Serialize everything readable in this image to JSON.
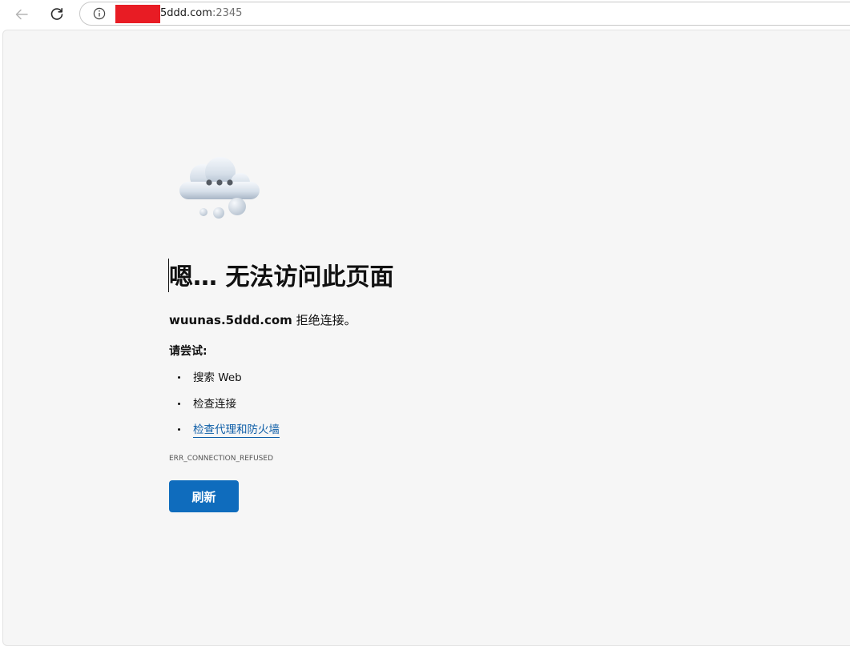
{
  "browser": {
    "url_visible": "5ddd.com",
    "url_port": ":2345",
    "icons": {
      "back": "arrow-left-icon",
      "refresh": "refresh-icon",
      "site_info": "info-circle-icon"
    }
  },
  "error_page": {
    "illustration": "cloud-icon",
    "title": "嗯… 无法访问此页面",
    "refused_host": "wuunas.5ddd.com",
    "refused_suffix": " 拒绝连接。",
    "try_heading": "请尝试:",
    "suggestions": [
      {
        "label": "搜索 Web",
        "link": false
      },
      {
        "label": "检查连接",
        "link": false
      },
      {
        "label": "检查代理和防火墙",
        "link": true
      }
    ],
    "error_code": "ERR_CONNECTION_REFUSED",
    "reload_label": "刷新",
    "colors": {
      "button": "#0f6cbd",
      "link": "#0f5fa8",
      "redaction": "#e81c24"
    }
  }
}
